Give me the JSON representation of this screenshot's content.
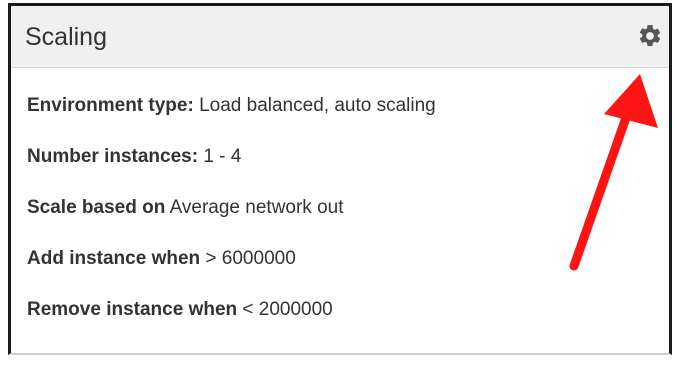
{
  "panel": {
    "title": "Scaling",
    "settings_icon": "gear-icon"
  },
  "rows": [
    {
      "label": "Environment type:",
      "value": "Load balanced, auto scaling"
    },
    {
      "label": "Number instances:",
      "value": "1 - 4"
    },
    {
      "label": "Scale based on",
      "value": "Average network out"
    },
    {
      "label": "Add instance when",
      "value": "> 6000000"
    },
    {
      "label": "Remove instance when",
      "value": "< 2000000"
    }
  ],
  "annotation": {
    "arrow_color": "#ff1414",
    "icon": "arrow-annotation"
  },
  "colors": {
    "header_bg": "#f0f0f0",
    "text": "#333333",
    "gear": "#555555"
  }
}
